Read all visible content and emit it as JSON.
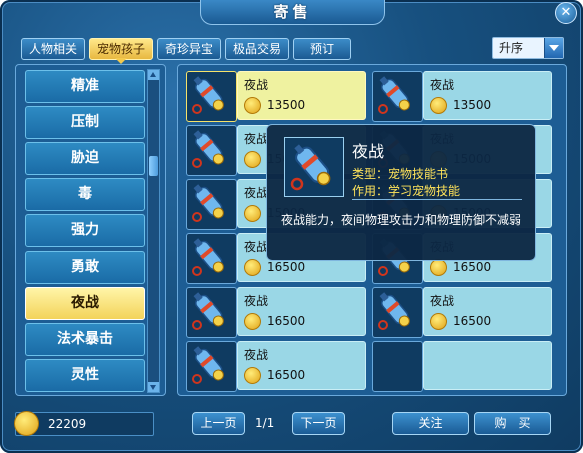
{
  "window": {
    "title": "寄售",
    "close_label": "✕"
  },
  "tabs": [
    "人物相关",
    "宠物孩子",
    "奇珍异宝",
    "极品交易",
    "预订"
  ],
  "sort": {
    "selected": "升序"
  },
  "categories": [
    "精准",
    "压制",
    "胁迫",
    "毒",
    "强力",
    "勇敢",
    "夜战",
    "法术暴击",
    "灵性"
  ],
  "items": [
    {
      "name": "夜战",
      "price": "13500"
    },
    {
      "name": "夜战",
      "price": "13500"
    },
    {
      "name": "夜战",
      "price": "15000"
    },
    {
      "name": "夜战",
      "price": "15000"
    },
    {
      "name": "夜战",
      "price": "15000"
    },
    {
      "name": "夜战",
      "price": "15000"
    },
    {
      "name": "夜战",
      "price": "16500"
    },
    {
      "name": "夜战",
      "price": "16500"
    },
    {
      "name": "夜战",
      "price": "16500"
    },
    {
      "name": "夜战",
      "price": "16500"
    },
    {
      "name": "夜战",
      "price": "16500"
    }
  ],
  "tooltip": {
    "title": "夜战",
    "type_line": "类型：宠物技能书",
    "effect_line": "作用：学习宠物技能",
    "description": "夜战能力，夜间物理攻击力和物理防御不减弱"
  },
  "footer": {
    "money": "22209",
    "prev_label": "上一页",
    "page": "1/1",
    "next_label": "下一页",
    "follow_label": "关注",
    "buy_label": "购　买"
  }
}
